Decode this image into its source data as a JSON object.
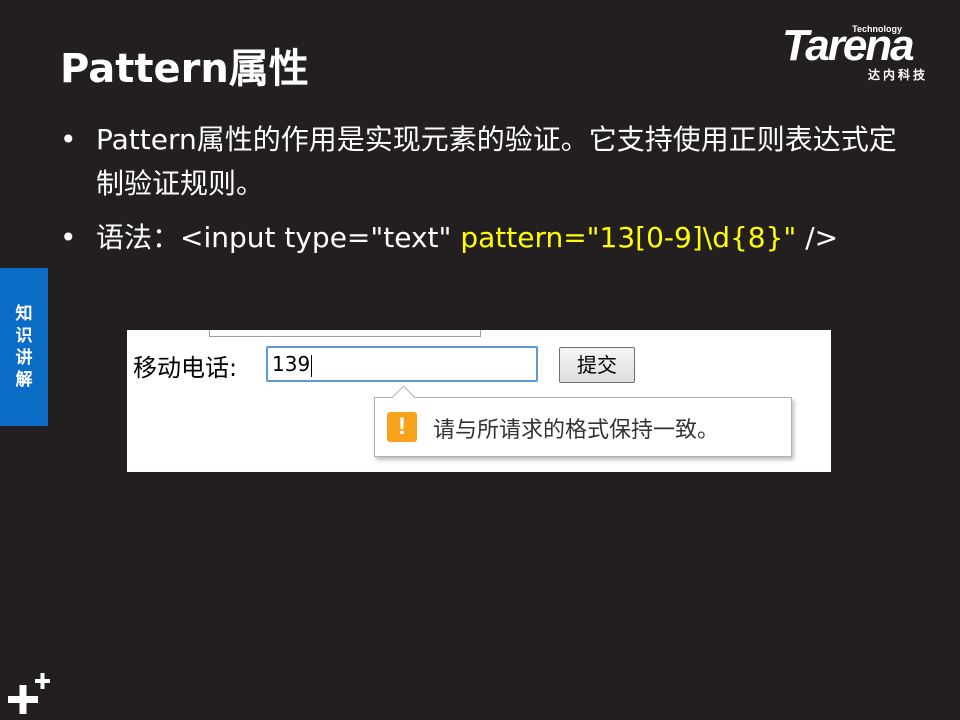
{
  "slide": {
    "title": "Pattern属性",
    "logo": {
      "technology": "Technology",
      "brand": "Tarena",
      "subtitle": "达内科技"
    },
    "side_tab": [
      "知",
      "识",
      "讲",
      "解"
    ],
    "bullets": [
      {
        "marker": "•",
        "text": "Pattern属性的作用是实现元素的验证。它支持使用正则表达式定制验证规则。"
      },
      {
        "marker": "•",
        "prefix": "语法：<input type=\"text\" ",
        "highlight": "pattern=\"13[0-9]\\d{8}\"",
        "suffix": " />"
      }
    ],
    "colors": {
      "background": "#231f20",
      "highlight": "#ffff00",
      "side_tab": "#0a6cc4",
      "warning": "#f7a21b"
    }
  },
  "screenshot": {
    "phone_label": "移动电话:",
    "phone_value": "139",
    "submit_label": "提交",
    "tooltip": {
      "icon": "warning-icon",
      "icon_glyph": "!",
      "message": "请与所请求的格式保持一致。"
    }
  }
}
